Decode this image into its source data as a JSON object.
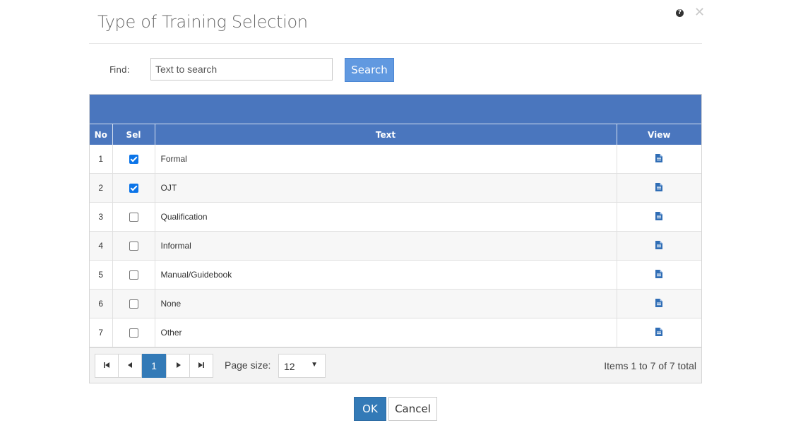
{
  "dialog": {
    "title": "Type of Training Selection",
    "help_icon": "question-circle-icon",
    "close_icon": "close-icon",
    "close_glyph": "✕",
    "help_glyph": "?"
  },
  "search": {
    "label": "Find:",
    "placeholder": "Text to search",
    "value": "",
    "button_label": "Search"
  },
  "table": {
    "columns": [
      "No",
      "Sel",
      "Text",
      "View"
    ],
    "rows": [
      {
        "no": "1",
        "selected": true,
        "text": "Formal",
        "view_icon": "document-icon"
      },
      {
        "no": "2",
        "selected": true,
        "text": "OJT",
        "view_icon": "document-icon"
      },
      {
        "no": "3",
        "selected": false,
        "text": "Qualification",
        "view_icon": "document-icon"
      },
      {
        "no": "4",
        "selected": false,
        "text": "Informal",
        "view_icon": "document-icon"
      },
      {
        "no": "5",
        "selected": false,
        "text": "Manual/Guidebook",
        "view_icon": "document-icon"
      },
      {
        "no": "6",
        "selected": false,
        "text": "None",
        "view_icon": "document-icon"
      },
      {
        "no": "7",
        "selected": false,
        "text": "Other",
        "view_icon": "document-icon"
      }
    ]
  },
  "pager": {
    "first_glyph": "⏮",
    "prev_glyph": "◀",
    "current_page": "1",
    "next_glyph": "▶",
    "last_glyph": "⏭",
    "page_size_label": "Page size:",
    "page_size": "12",
    "dropdown_glyph": "▼",
    "items_info": "Items 1 to 7 of 7 total"
  },
  "footer": {
    "ok_label": "OK",
    "cancel_label": "Cancel"
  },
  "colors": {
    "header_bg": "#4a76be",
    "search_button": "#6199e0",
    "primary_button": "#337ab7",
    "checkbox_checked": "#0b74e8",
    "view_icon": "#2f6db5"
  }
}
